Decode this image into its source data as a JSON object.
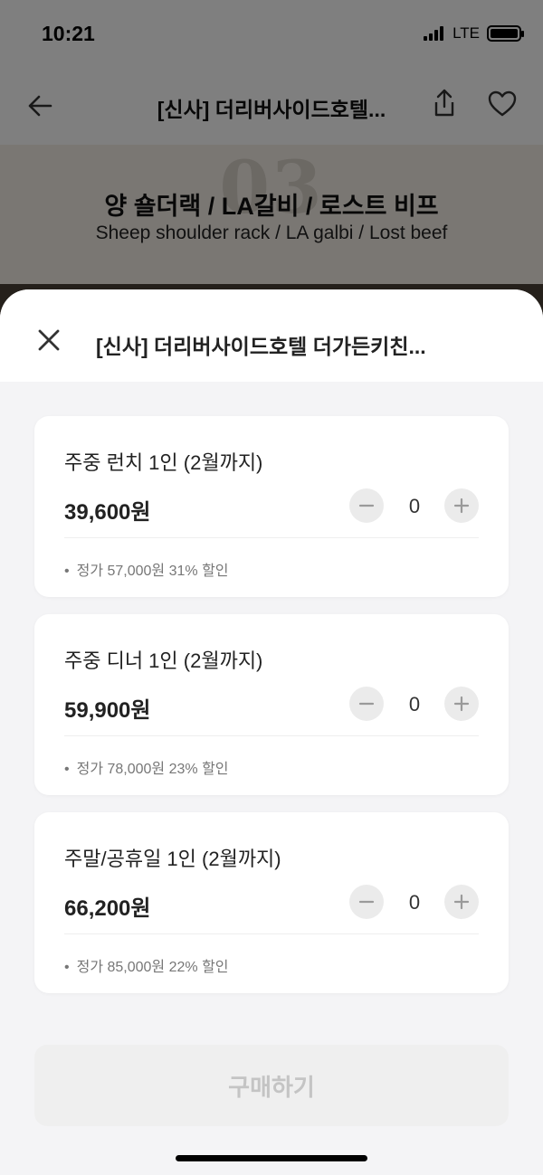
{
  "status_bar": {
    "time": "10:21",
    "network": "LTE"
  },
  "nav": {
    "title": "[신사] 더리버사이드호텔..."
  },
  "hero": {
    "number": "03",
    "title": "양 숄더랙 / LA갈비 / 로스트 비프",
    "subtitle": "Sheep shoulder rack / LA galbi / Lost beef"
  },
  "sheet": {
    "title": "[신사] 더리버사이드호텔 더가든키친...",
    "options": [
      {
        "name": "주중 런치 1인 (2월까지)",
        "price": "39,600원",
        "quantity": "0",
        "note": "정가 57,000원 31% 할인"
      },
      {
        "name": "주중 디너 1인 (2월까지)",
        "price": "59,900원",
        "quantity": "0",
        "note": "정가 78,000원 23% 할인"
      },
      {
        "name": "주말/공휴일 1인 (2월까지)",
        "price": "66,200원",
        "quantity": "0",
        "note": "정가 85,000원 22% 할인"
      }
    ],
    "purchase_label": "구매하기"
  },
  "colors": {
    "overlay": "rgba(0,0,0,0.5)",
    "sheet_background": "#f4f4f6",
    "card_background": "#ffffff",
    "stepper_background": "#ebebeb",
    "purchase_disabled_bg": "#efefef",
    "purchase_disabled_text": "#c4c4c4"
  },
  "icons": {
    "back": "arrow-left-icon",
    "share": "share-icon",
    "favorite": "heart-icon",
    "close": "close-icon",
    "minus": "minus-icon",
    "plus": "plus-icon"
  }
}
